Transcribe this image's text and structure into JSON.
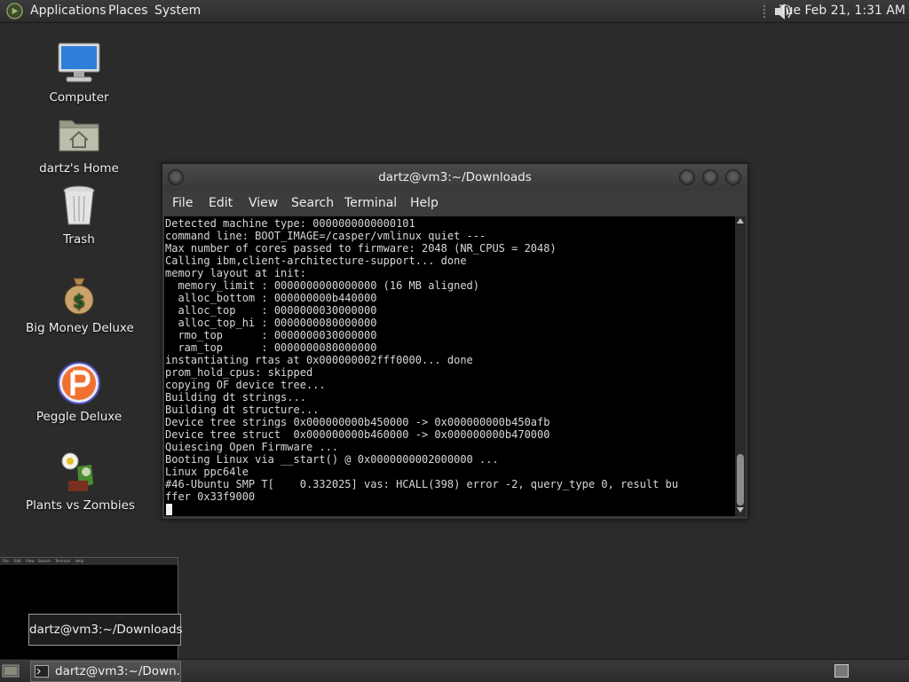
{
  "top_panel": {
    "menu": [
      "Applications",
      "Places",
      "System"
    ],
    "clock": "Tue Feb 21,  1:31 AM",
    "icons": [
      "gnome-foot-logo-icon",
      "volume-icon"
    ]
  },
  "desktop_icons": [
    {
      "label": "Computer",
      "icon": "computer-icon"
    },
    {
      "label": "dartz's Home",
      "icon": "home-folder-icon"
    },
    {
      "label": "Trash",
      "icon": "trash-icon"
    },
    {
      "label": "Big Money Deluxe",
      "icon": "money-bag-icon"
    },
    {
      "label": "Peggle Deluxe",
      "icon": "peggle-icon"
    },
    {
      "label": "Plants vs Zombies",
      "icon": "plants-vs-zombies-icon"
    }
  ],
  "terminal": {
    "title": "dartz@vm3:~/Downloads",
    "menu": [
      "File",
      "Edit",
      "View",
      "Search",
      "Terminal",
      "Help"
    ],
    "lines": [
      "Detected machine type: 0000000000000101",
      "command line: BOOT_IMAGE=/casper/vmlinux quiet ---",
      "Max number of cores passed to firmware: 2048 (NR_CPUS = 2048)",
      "Calling ibm,client-architecture-support... done",
      "memory layout at init:",
      "  memory_limit : 0000000000000000 (16 MB aligned)",
      "  alloc_bottom : 000000000b440000",
      "  alloc_top    : 0000000030000000",
      "  alloc_top_hi : 0000000080000000",
      "  rmo_top      : 0000000030000000",
      "  ram_top      : 0000000080000000",
      "instantiating rtas at 0x000000002fff0000... done",
      "prom_hold_cpus: skipped",
      "copying OF device tree...",
      "Building dt strings...",
      "Building dt structure...",
      "Device tree strings 0x000000000b450000 -> 0x000000000b450afb",
      "Device tree struct  0x000000000b460000 -> 0x000000000b470000",
      "Quiescing Open Firmware ...",
      "Booting Linux via __start() @ 0x0000000002000000 ...",
      "Linux ppc64le",
      "#46-Ubuntu SMP T[    0.332025] vas: HCALL(398) error -2, query_type 0, result bu",
      "ffer 0x33f9000"
    ]
  },
  "thumbnail": {
    "menu": [
      "File",
      "Edit",
      "View",
      "Search",
      "Terminal",
      "Help"
    ]
  },
  "tooltip": {
    "text": "dartz@vm3:~/Downloads"
  },
  "taskbar": {
    "task_label": "dartz@vm3:~/Down...",
    "icons": [
      "show-desktop-icon",
      "terminal-icon",
      "workspace-switcher-icon"
    ]
  }
}
